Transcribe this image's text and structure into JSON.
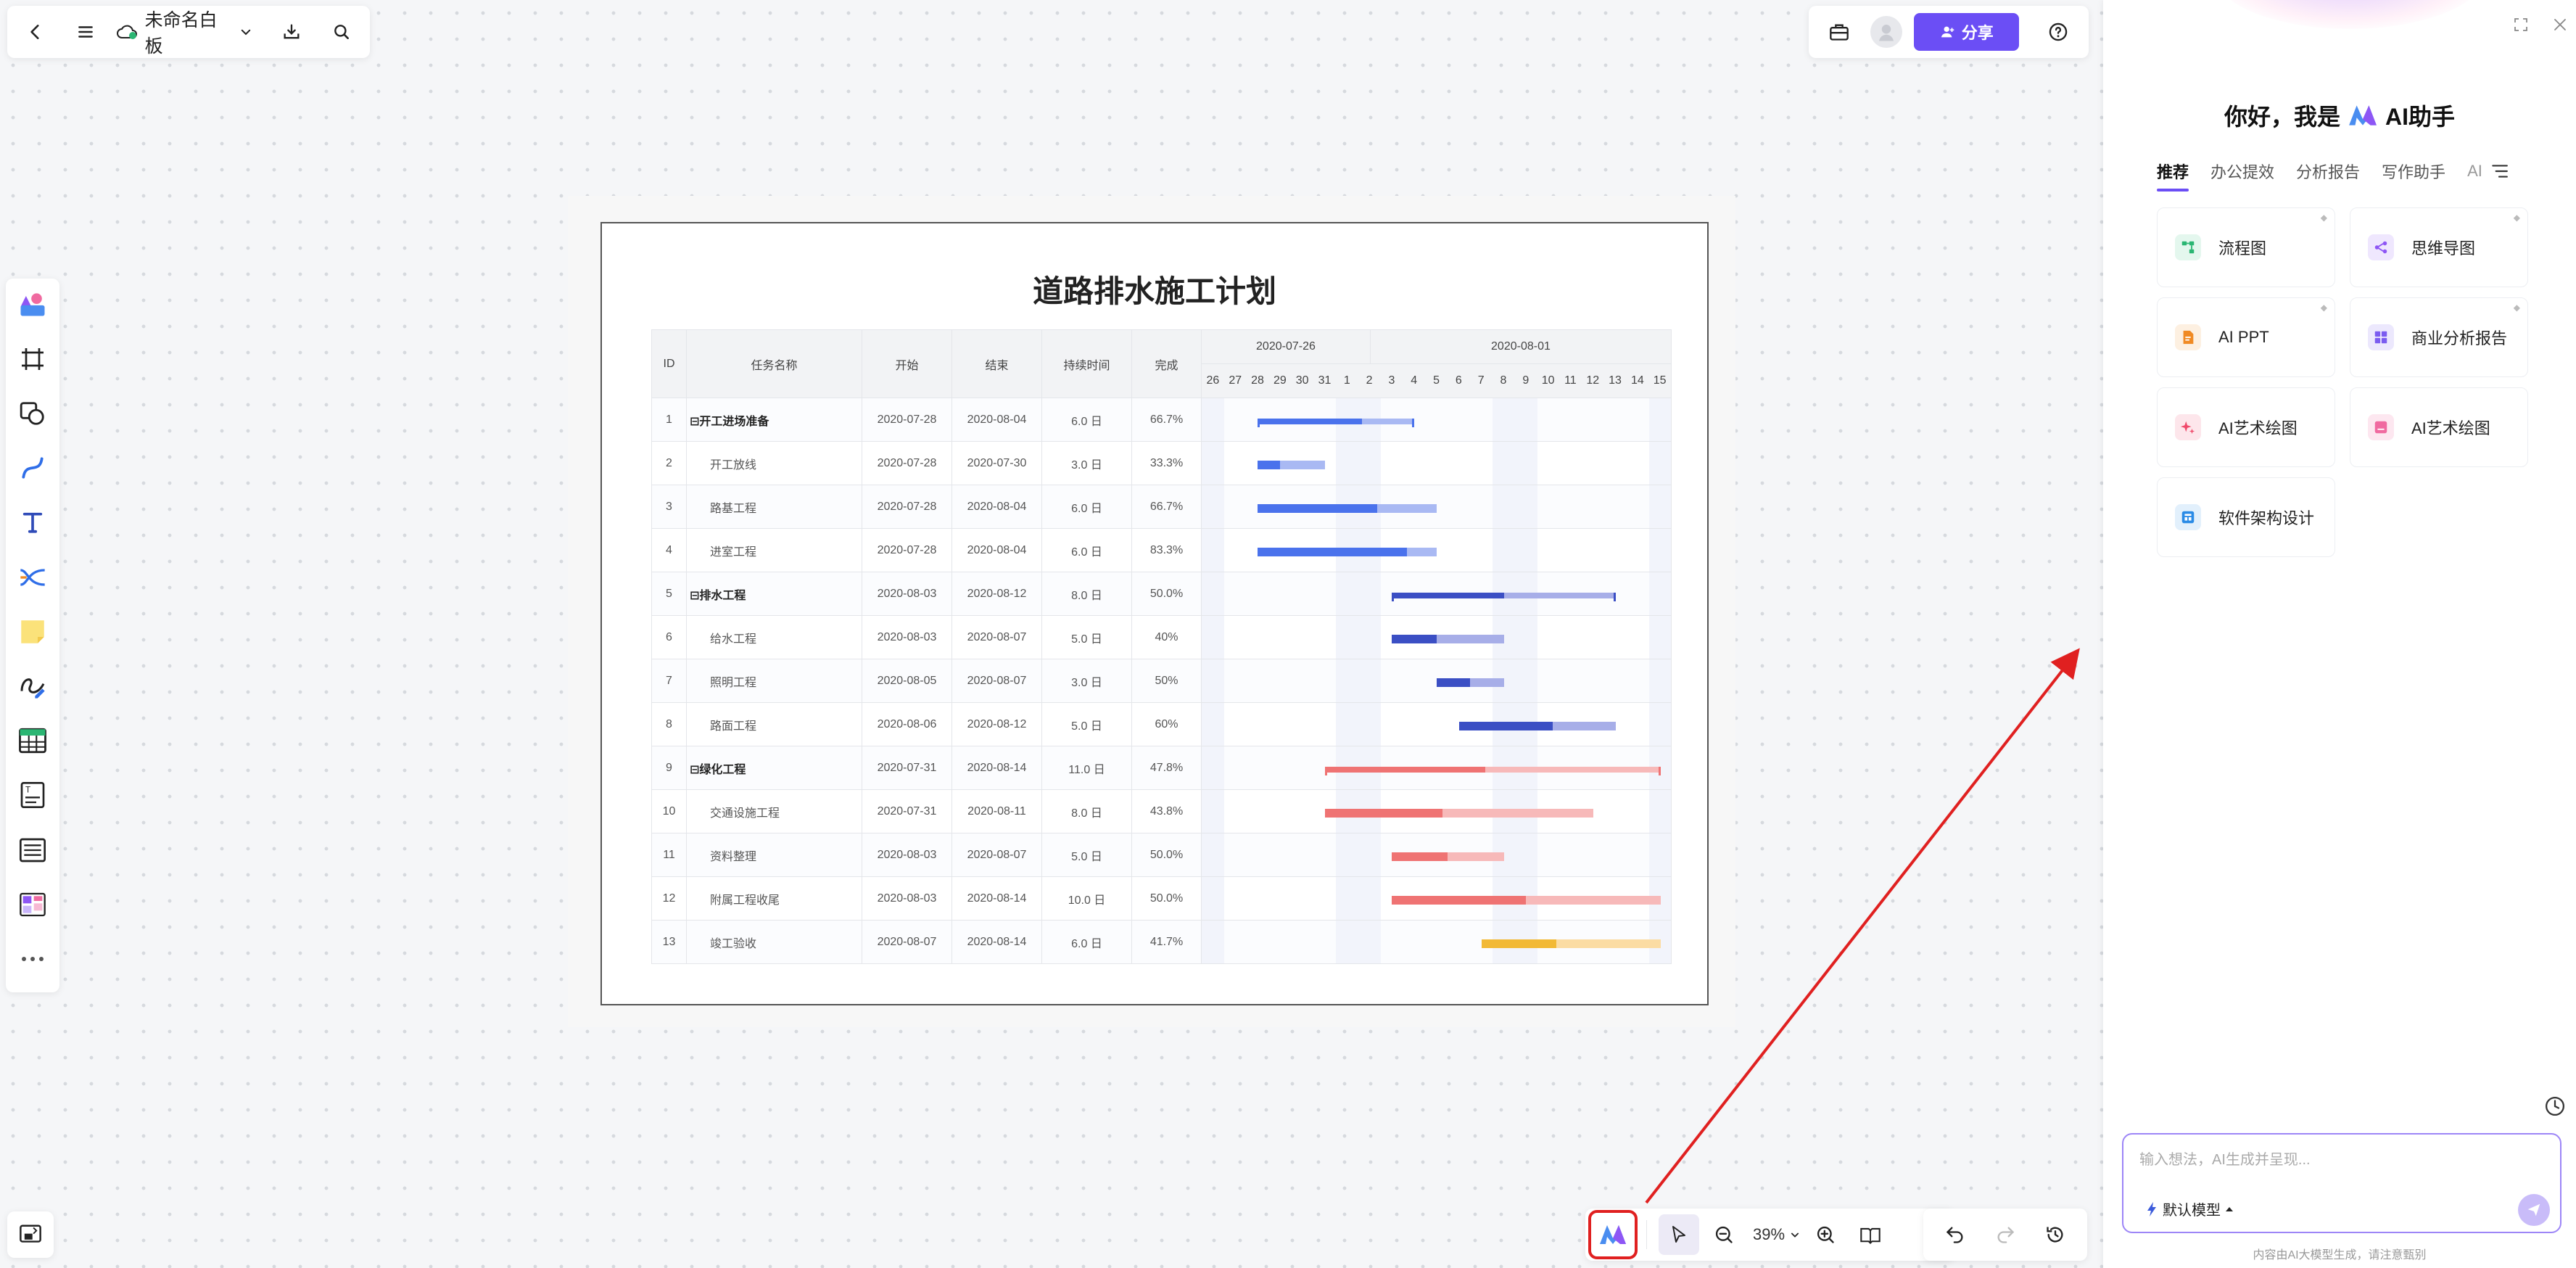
{
  "app": {
    "board_title": "未命名白板",
    "share_label": "分享",
    "zoom": "39%"
  },
  "icons": {
    "back": "chevron-left-icon",
    "menu": "hamburger-menu-icon",
    "cloud": "cloud-sync-icon",
    "download": "download-icon",
    "search": "search-icon",
    "toolbox": "toolbox-icon",
    "help": "help-icon"
  },
  "document": {
    "title": "道路排水施工计划",
    "headers": {
      "id": "ID",
      "name": "任务名称",
      "start": "开始",
      "end": "结束",
      "duration": "持续时间",
      "complete": "完成",
      "week1": "2020-07-26",
      "week2": "2020-08-01"
    },
    "days": [
      "26",
      "27",
      "28",
      "29",
      "30",
      "31",
      "1",
      "2",
      "3",
      "4",
      "5",
      "6",
      "7",
      "8",
      "9",
      "10",
      "11",
      "12",
      "13",
      "14",
      "15"
    ],
    "tasks": [
      {
        "id": "1",
        "name": "⊟开工进场准备",
        "start": "2020-07-28",
        "end": "2020-08-04",
        "duration": "6.0 日",
        "complete": "66.7%",
        "group": true,
        "startIdx": 2,
        "endIdx": 9,
        "pct": 0.667,
        "color": "#4a72ec",
        "light": "#a9b9f3"
      },
      {
        "id": "2",
        "name": "开工放线",
        "start": "2020-07-28",
        "end": "2020-07-30",
        "duration": "3.0 日",
        "complete": "33.3%",
        "group": false,
        "startIdx": 2,
        "endIdx": 5,
        "pct": 0.333,
        "color": "#4a72ec",
        "light": "#a9b9f3"
      },
      {
        "id": "3",
        "name": "路基工程",
        "start": "2020-07-28",
        "end": "2020-08-04",
        "duration": "6.0 日",
        "complete": "66.7%",
        "group": false,
        "startIdx": 2,
        "endIdx": 10,
        "pct": 0.667,
        "color": "#4a72ec",
        "light": "#a9b9f3"
      },
      {
        "id": "4",
        "name": "进室工程",
        "start": "2020-07-28",
        "end": "2020-08-04",
        "duration": "6.0 日",
        "complete": "83.3%",
        "group": false,
        "startIdx": 2,
        "endIdx": 10,
        "pct": 0.833,
        "color": "#4a72ec",
        "light": "#a9b9f3"
      },
      {
        "id": "5",
        "name": "⊟排水工程",
        "start": "2020-08-03",
        "end": "2020-08-12",
        "duration": "8.0 日",
        "complete": "50.0%",
        "group": true,
        "startIdx": 8,
        "endIdx": 18,
        "pct": 0.5,
        "color": "#3b4fc4",
        "light": "#a7aee8"
      },
      {
        "id": "6",
        "name": "给水工程",
        "start": "2020-08-03",
        "end": "2020-08-07",
        "duration": "5.0 日",
        "complete": "40%",
        "group": false,
        "startIdx": 8,
        "endIdx": 13,
        "pct": 0.4,
        "color": "#3b4fc4",
        "light": "#a7aee8"
      },
      {
        "id": "7",
        "name": "照明工程",
        "start": "2020-08-05",
        "end": "2020-08-07",
        "duration": "3.0 日",
        "complete": "50%",
        "group": false,
        "startIdx": 10,
        "endIdx": 13,
        "pct": 0.5,
        "color": "#3b4fc4",
        "light": "#a7aee8"
      },
      {
        "id": "8",
        "name": "路面工程",
        "start": "2020-08-06",
        "end": "2020-08-12",
        "duration": "5.0 日",
        "complete": "60%",
        "group": false,
        "startIdx": 11,
        "endIdx": 18,
        "pct": 0.6,
        "color": "#3b4fc4",
        "light": "#a7aee8"
      },
      {
        "id": "9",
        "name": "⊟绿化工程",
        "start": "2020-07-31",
        "end": "2020-08-14",
        "duration": "11.0 日",
        "complete": "47.8%",
        "group": true,
        "startIdx": 5,
        "endIdx": 20,
        "pct": 0.478,
        "color": "#ef7373",
        "light": "#f7b9b9"
      },
      {
        "id": "10",
        "name": "交通设施工程",
        "start": "2020-07-31",
        "end": "2020-08-11",
        "duration": "8.0 日",
        "complete": "43.8%",
        "group": false,
        "startIdx": 5,
        "endIdx": 17,
        "pct": 0.438,
        "color": "#ef7373",
        "light": "#f7b9b9"
      },
      {
        "id": "11",
        "name": "资料整理",
        "start": "2020-08-03",
        "end": "2020-08-07",
        "duration": "5.0 日",
        "complete": "50.0%",
        "group": false,
        "startIdx": 8,
        "endIdx": 13,
        "pct": 0.5,
        "color": "#ef7373",
        "light": "#f7b9b9"
      },
      {
        "id": "12",
        "name": "附属工程收尾",
        "start": "2020-08-03",
        "end": "2020-08-14",
        "duration": "10.0 日",
        "complete": "50.0%",
        "group": false,
        "startIdx": 8,
        "endIdx": 20,
        "pct": 0.5,
        "color": "#ef7373",
        "light": "#f7b9b9"
      },
      {
        "id": "13",
        "name": "竣工验收",
        "start": "2020-08-07",
        "end": "2020-08-14",
        "duration": "6.0 日",
        "complete": "41.7%",
        "group": false,
        "startIdx": 12,
        "endIdx": 20,
        "pct": 0.417,
        "color": "#f2b935",
        "light": "#fbdca3"
      }
    ]
  },
  "ai_panel": {
    "greeting_prefix": "你好，我是",
    "greeting_suffix": "AI助手",
    "tabs": [
      "推荐",
      "办公提效",
      "分析报告",
      "写作助手",
      "AI"
    ],
    "cards": [
      {
        "label": "流程图",
        "icon": "flowchart-icon",
        "color": "#2bb673",
        "bg": "#e4f7ee"
      },
      {
        "label": "思维导图",
        "icon": "mindmap-icon",
        "color": "#8e56f5",
        "bg": "#efe7fe"
      },
      {
        "label": "AI PPT",
        "icon": "ppt-icon",
        "color": "#f08a24",
        "bg": "#fdf0e1"
      },
      {
        "label": "商业分析报告",
        "icon": "business-report-icon",
        "color": "#7b5cf0",
        "bg": "#ece8fd"
      },
      {
        "label": "AI艺术绘图",
        "icon": "ai-art-sparkle-icon",
        "color": "#f04a6b",
        "bg": "#fde6eb"
      },
      {
        "label": "AI艺术绘图",
        "icon": "ai-art-image-icon",
        "color": "#f06aa0",
        "bg": "#fde7f0"
      },
      {
        "label": "软件架构设计",
        "icon": "software-architecture-icon",
        "color": "#2a8be6",
        "bg": "#e2f0fc"
      }
    ],
    "input_placeholder": "输入想法，AI生成并呈现...",
    "model_label": "默认模型",
    "disclaimer": "内容由AI大模型生成，请注意甄别"
  }
}
